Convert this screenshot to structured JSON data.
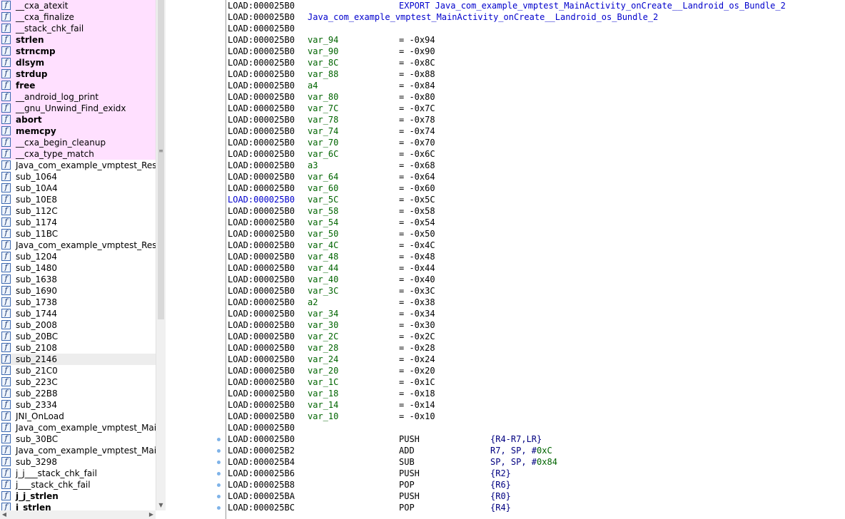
{
  "functions_pane": {
    "icon_glyph": "f",
    "items": [
      {
        "name": "__cxa_atexit",
        "style": "lib"
      },
      {
        "name": "__cxa_finalize",
        "style": "lib"
      },
      {
        "name": "__stack_chk_fail",
        "style": "lib"
      },
      {
        "name": "strlen",
        "style": "lib-bold"
      },
      {
        "name": "strncmp",
        "style": "lib-bold"
      },
      {
        "name": "dlsym",
        "style": "lib-bold"
      },
      {
        "name": "strdup",
        "style": "lib-bold"
      },
      {
        "name": "free",
        "style": "lib-bold"
      },
      {
        "name": "__android_log_print",
        "style": "lib"
      },
      {
        "name": "__gnu_Unwind_Find_exidx",
        "style": "lib"
      },
      {
        "name": "abort",
        "style": "lib-bold"
      },
      {
        "name": "memcpy",
        "style": "lib-bold"
      },
      {
        "name": "__cxa_begin_cleanup",
        "style": "lib"
      },
      {
        "name": "__cxa_type_match",
        "style": "lib"
      },
      {
        "name": "Java_com_example_vmptest_Resul",
        "style": "normal"
      },
      {
        "name": "sub_1064",
        "style": "normal"
      },
      {
        "name": "sub_10A4",
        "style": "normal"
      },
      {
        "name": "sub_10E8",
        "style": "normal"
      },
      {
        "name": "sub_112C",
        "style": "normal"
      },
      {
        "name": "sub_1174",
        "style": "normal"
      },
      {
        "name": "sub_11BC",
        "style": "normal"
      },
      {
        "name": "Java_com_example_vmptest_Resul",
        "style": "normal"
      },
      {
        "name": "sub_1204",
        "style": "normal"
      },
      {
        "name": "sub_1480",
        "style": "normal"
      },
      {
        "name": "sub_1638",
        "style": "normal"
      },
      {
        "name": "sub_1690",
        "style": "normal"
      },
      {
        "name": "sub_1738",
        "style": "normal"
      },
      {
        "name": "sub_1744",
        "style": "normal"
      },
      {
        "name": "sub_2008",
        "style": "normal"
      },
      {
        "name": "sub_20BC",
        "style": "normal"
      },
      {
        "name": "sub_2108",
        "style": "normal"
      },
      {
        "name": "sub_2146",
        "style": "selected"
      },
      {
        "name": "sub_21C0",
        "style": "normal"
      },
      {
        "name": "sub_223C",
        "style": "normal"
      },
      {
        "name": "sub_22B8",
        "style": "normal"
      },
      {
        "name": "sub_2334",
        "style": "normal"
      },
      {
        "name": "JNI_OnLoad",
        "style": "normal"
      },
      {
        "name": "Java_com_example_vmptest_Main.",
        "style": "normal"
      },
      {
        "name": "sub_30BC",
        "style": "normal"
      },
      {
        "name": "Java_com_example_vmptest_Main.",
        "style": "normal"
      },
      {
        "name": "sub_3298",
        "style": "normal"
      },
      {
        "name": "j_j___stack_chk_fail",
        "style": "normal"
      },
      {
        "name": "j___stack_chk_fail",
        "style": "normal"
      },
      {
        "name": "j_j_strlen",
        "style": "bold"
      },
      {
        "name": "j_strlen",
        "style": "bold"
      }
    ]
  },
  "scrollbar": {
    "up_arrow": "▲",
    "down_arrow": "▼",
    "left_arrow": "◀",
    "right_arrow": "▶",
    "grip": "≡"
  },
  "disassembly": {
    "lines": [
      {
        "kind": "export",
        "addr": "LOAD:000025B0",
        "text": "EXPORT Java_com_example_vmptest_MainActivity_onCreate__Landroid_os_Bundle_2"
      },
      {
        "kind": "label",
        "addr": "LOAD:000025B0",
        "text": "Java_com_example_vmptest_MainActivity_onCreate__Landroid_os_Bundle_2"
      },
      {
        "kind": "blank",
        "addr": "LOAD:000025B0"
      },
      {
        "kind": "var",
        "addr": "LOAD:000025B0",
        "name": "var_94",
        "value": "= -0x94"
      },
      {
        "kind": "var",
        "addr": "LOAD:000025B0",
        "name": "var_90",
        "value": "= -0x90"
      },
      {
        "kind": "var",
        "addr": "LOAD:000025B0",
        "name": "var_8C",
        "value": "= -0x8C"
      },
      {
        "kind": "var",
        "addr": "LOAD:000025B0",
        "name": "var_88",
        "value": "= -0x88"
      },
      {
        "kind": "var",
        "addr": "LOAD:000025B0",
        "name": "a4",
        "value": "= -0x84"
      },
      {
        "kind": "var",
        "addr": "LOAD:000025B0",
        "name": "var_80",
        "value": "= -0x80"
      },
      {
        "kind": "var",
        "addr": "LOAD:000025B0",
        "name": "var_7C",
        "value": "= -0x7C"
      },
      {
        "kind": "var",
        "addr": "LOAD:000025B0",
        "name": "var_78",
        "value": "= -0x78"
      },
      {
        "kind": "var",
        "addr": "LOAD:000025B0",
        "name": "var_74",
        "value": "= -0x74"
      },
      {
        "kind": "var",
        "addr": "LOAD:000025B0",
        "name": "var_70",
        "value": "= -0x70"
      },
      {
        "kind": "var",
        "addr": "LOAD:000025B0",
        "name": "var_6C",
        "value": "= -0x6C"
      },
      {
        "kind": "var",
        "addr": "LOAD:000025B0",
        "name": "a3",
        "value": "= -0x68"
      },
      {
        "kind": "var",
        "addr": "LOAD:000025B0",
        "name": "var_64",
        "value": "= -0x64"
      },
      {
        "kind": "var",
        "addr": "LOAD:000025B0",
        "name": "var_60",
        "value": "= -0x60"
      },
      {
        "kind": "var",
        "addr": "LOAD:000025B0",
        "name": "var_5C",
        "value": "= -0x5C",
        "addr_color": "#0000cc"
      },
      {
        "kind": "var",
        "addr": "LOAD:000025B0",
        "name": "var_58",
        "value": "= -0x58"
      },
      {
        "kind": "var",
        "addr": "LOAD:000025B0",
        "name": "var_54",
        "value": "= -0x54"
      },
      {
        "kind": "var",
        "addr": "LOAD:000025B0",
        "name": "var_50",
        "value": "= -0x50"
      },
      {
        "kind": "var",
        "addr": "LOAD:000025B0",
        "name": "var_4C",
        "value": "= -0x4C"
      },
      {
        "kind": "var",
        "addr": "LOAD:000025B0",
        "name": "var_48",
        "value": "= -0x48"
      },
      {
        "kind": "var",
        "addr": "LOAD:000025B0",
        "name": "var_44",
        "value": "= -0x44"
      },
      {
        "kind": "var",
        "addr": "LOAD:000025B0",
        "name": "var_40",
        "value": "= -0x40"
      },
      {
        "kind": "var",
        "addr": "LOAD:000025B0",
        "name": "var_3C",
        "value": "= -0x3C"
      },
      {
        "kind": "var",
        "addr": "LOAD:000025B0",
        "name": "a2",
        "value": "= -0x38"
      },
      {
        "kind": "var",
        "addr": "LOAD:000025B0",
        "name": "var_34",
        "value": "= -0x34"
      },
      {
        "kind": "var",
        "addr": "LOAD:000025B0",
        "name": "var_30",
        "value": "= -0x30"
      },
      {
        "kind": "var",
        "addr": "LOAD:000025B0",
        "name": "var_2C",
        "value": "= -0x2C"
      },
      {
        "kind": "var",
        "addr": "LOAD:000025B0",
        "name": "var_28",
        "value": "= -0x28"
      },
      {
        "kind": "var",
        "addr": "LOAD:000025B0",
        "name": "var_24",
        "value": "= -0x24"
      },
      {
        "kind": "var",
        "addr": "LOAD:000025B0",
        "name": "var_20",
        "value": "= -0x20"
      },
      {
        "kind": "var",
        "addr": "LOAD:000025B0",
        "name": "var_1C",
        "value": "= -0x1C"
      },
      {
        "kind": "var",
        "addr": "LOAD:000025B0",
        "name": "var_18",
        "value": "= -0x18"
      },
      {
        "kind": "var",
        "addr": "LOAD:000025B0",
        "name": "var_14",
        "value": "= -0x14"
      },
      {
        "kind": "var",
        "addr": "LOAD:000025B0",
        "name": "var_10",
        "value": "= -0x10"
      },
      {
        "kind": "blank",
        "addr": "LOAD:000025B0"
      },
      {
        "kind": "insn",
        "addr": "LOAD:000025B0",
        "mnemonic": "PUSH",
        "ops": [
          {
            "t": "{R4-R7,LR}"
          }
        ]
      },
      {
        "kind": "insn",
        "addr": "LOAD:000025B2",
        "mnemonic": "ADD",
        "ops": [
          {
            "t": "R7, SP, #"
          },
          {
            "t": "0xC",
            "c": "#006400"
          }
        ]
      },
      {
        "kind": "insn",
        "addr": "LOAD:000025B4",
        "mnemonic": "SUB",
        "ops": [
          {
            "t": "SP, SP, #"
          },
          {
            "t": "0x84",
            "c": "#006400"
          }
        ]
      },
      {
        "kind": "insn",
        "addr": "LOAD:000025B6",
        "mnemonic": "PUSH",
        "ops": [
          {
            "t": "{R2}"
          }
        ]
      },
      {
        "kind": "insn",
        "addr": "LOAD:000025B8",
        "mnemonic": "POP",
        "ops": [
          {
            "t": "{R6}"
          }
        ]
      },
      {
        "kind": "insn",
        "addr": "LOAD:000025BA",
        "mnemonic": "PUSH",
        "ops": [
          {
            "t": "{R0}"
          }
        ]
      },
      {
        "kind": "insn",
        "addr": "LOAD:000025BC",
        "mnemonic": "POP",
        "ops": [
          {
            "t": "{R4}"
          }
        ]
      }
    ]
  },
  "colors": {
    "lib_bg": "#ffe0ff",
    "selected_bg": "#ededed",
    "var_name": "#006400",
    "export": "#0000cc",
    "operand": "#000080",
    "flow_dot": "#7fb3e8"
  }
}
